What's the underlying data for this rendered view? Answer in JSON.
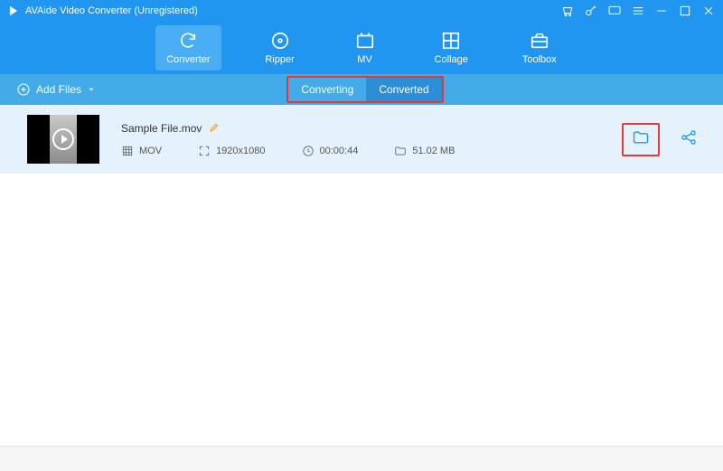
{
  "app": {
    "title": "AVAide Video Converter (Unregistered)"
  },
  "tabs": {
    "converter": "Converter",
    "ripper": "Ripper",
    "mv": "MV",
    "collage": "Collage",
    "toolbox": "Toolbox"
  },
  "subbar": {
    "add_files": "Add Files",
    "converting": "Converting",
    "converted": "Converted"
  },
  "file": {
    "name": "Sample File.mov",
    "format": "MOV",
    "resolution": "1920x1080",
    "duration": "00:00:44",
    "size": "51.02 MB"
  }
}
